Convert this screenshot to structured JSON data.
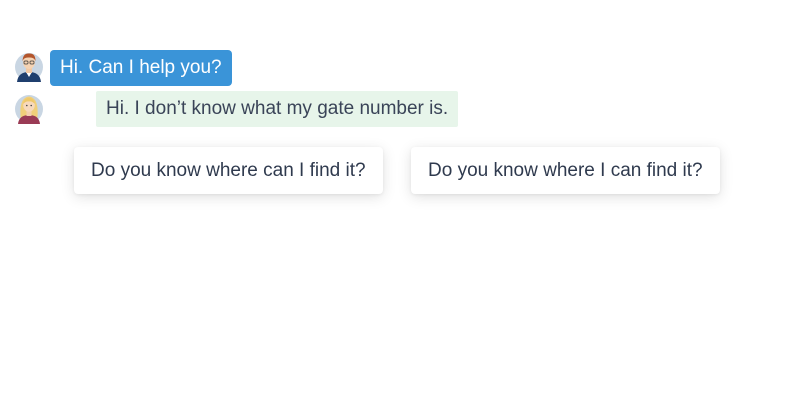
{
  "conversation": {
    "agent_message": "Hi. Can I help you?",
    "user_message": "Hi. I don’t know what my gate number is."
  },
  "choices": [
    "Do you know where can I find it?",
    "Do you know where I can find it?"
  ],
  "colors": {
    "agent_bubble": "#3a94d8",
    "user_bubble": "#e7f5ea",
    "text_dark": "#3a4458"
  },
  "icons": {
    "agent_avatar": "male-agent-avatar-icon",
    "user_avatar": "female-user-avatar-icon"
  }
}
